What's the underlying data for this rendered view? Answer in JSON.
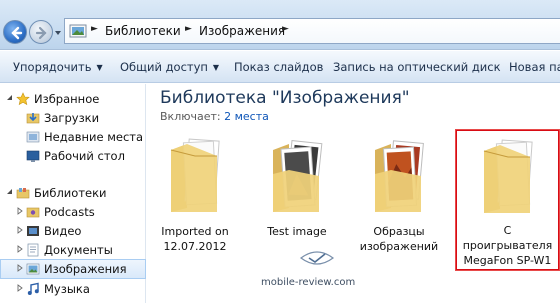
{
  "address_bar": {
    "crumbs": [
      "Библиотеки",
      "Изображения"
    ]
  },
  "toolbar": {
    "organize": "Упорядочить",
    "share": "Общий доступ",
    "slideshow": "Показ слайдов",
    "burn": "Запись на оптический диск",
    "new_folder": "Новая папк"
  },
  "nav": {
    "favorites": "Избранное",
    "downloads": "Загрузки",
    "recent": "Недавние места",
    "desktop": "Рабочий стол",
    "libraries": "Библиотеки",
    "podcasts": "Podcasts",
    "video": "Видео",
    "documents": "Документы",
    "images": "Изображения",
    "music": "Музыка"
  },
  "content": {
    "title": "Библиотека \"Изображения\"",
    "includes_label": "Включает:",
    "includes_link": "2 места",
    "items": [
      {
        "line1": "Imported on",
        "line2": "12.07.2012",
        "line3": ""
      },
      {
        "line1": "Test image",
        "line2": "",
        "line3": ""
      },
      {
        "line1": "Образцы",
        "line2": "изображений",
        "line3": ""
      },
      {
        "line1": "С",
        "line2": "проигрывателя",
        "line3": "MegaFon SP-W1"
      }
    ]
  },
  "watermark": "mobile-review.com",
  "colors": {
    "highlight_border": "#d80b14",
    "title_blue": "#1e395b",
    "link_blue": "#0f56b8"
  }
}
